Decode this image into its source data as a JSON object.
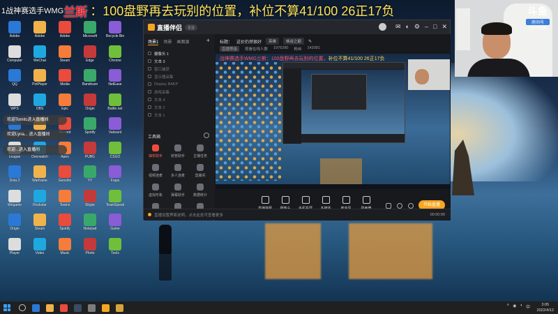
{
  "overlay": {
    "prefix": "1战神赛选手WMG",
    "prefix_red": "兰斯",
    "headline": "：100盘野再去玩别的位置，补位不算41/100 26正17负"
  },
  "chat": [
    "欢迎Tomitc进入直播间",
    "欢迎Lyna... 进入直播间",
    "欢迎...进入直播间"
  ],
  "desktop_icons": [
    "Adobe",
    "Adobe",
    "Adobe",
    "Microsoft",
    "Recycle Bin",
    "Computer",
    "WeChat",
    "Steam",
    "Edge",
    "Chrome",
    "QQ",
    "PotPlayer",
    "Media",
    "Bandicam",
    "NetEase",
    "WPS",
    "OBS",
    "Epic",
    "Origin",
    "Battle.net",
    "Uplay",
    "GOG",
    "Discord",
    "Spotify",
    "Valorant",
    "League",
    "Overwatch",
    "Apex",
    "PUBG",
    "CSGO",
    "Dota 2",
    "Warframe",
    "Genshin",
    "YY",
    "Fraps",
    "Wegame",
    "Rockstar",
    "Teams",
    "Skype",
    "TeamSpeak",
    "Origin",
    "Steam",
    "Spotify",
    "Notepad",
    "Game",
    "Player",
    "Video",
    "Music",
    "Photo",
    "Tools"
  ],
  "webcam_logo": {
    "brand": "斗鱼",
    "subtitle": "房间号",
    "room": "1976280"
  },
  "app": {
    "brand": "直播伴侣",
    "badge": "企业",
    "tabs": [
      "场景1",
      "场景",
      "画面源"
    ],
    "sources": [
      {
        "name": "摄像头 1",
        "on": true
      },
      {
        "name": "文本 3",
        "on": true
      },
      {
        "name": "窗口捕获",
        "on": false
      },
      {
        "name": "显示器采集",
        "on": false
      },
      {
        "name": "Display BAKP",
        "on": false
      },
      {
        "name": "游戏采集",
        "on": false
      },
      {
        "name": "文本 4",
        "on": false
      },
      {
        "name": "文本 2",
        "on": false
      },
      {
        "name": "文本 1",
        "on": false
      }
    ],
    "tools_title": "工具箱",
    "tools": [
      {
        "label": "抽奖助手",
        "hot": true
      },
      {
        "label": "房管助手",
        "hot": false
      },
      {
        "label": "主播任务",
        "hot": false
      },
      {
        "label": "视频连麦",
        "hot": false
      },
      {
        "label": "多人连麦",
        "hot": false
      },
      {
        "label": "直播间",
        "hot": false
      },
      {
        "label": "虚拟形象",
        "hot": false
      },
      {
        "label": "弹幕助手",
        "hot": false
      },
      {
        "label": "数据统计",
        "hot": false
      },
      {
        "label": "画中画",
        "hot": false
      },
      {
        "label": "背景音乐",
        "hot": false
      },
      {
        "label": "更多",
        "hot": false
      }
    ],
    "topinfo": {
      "label": "标题：",
      "title": "这价仍然很好",
      "category": "英雄",
      "tag": "峡谷之巅"
    },
    "row2": {
      "level": "直播等级",
      "fans_label": "粉丝",
      "room_label": "观看在线人数",
      "viewers": "1976280",
      "hot": "142081"
    },
    "preview_ticker_red": "战神赛选手WMG兰斯：100盘野再去玩别的位置，",
    "preview_ticker_yellow": "补位不算41/100 26正17负",
    "actions": [
      "直播弹幕",
      "摄像头",
      "手机投屏",
      "多媒体",
      "麦克风",
      "扬声器"
    ],
    "go_live": "开始直播",
    "status": "直播设置界面说明，点击此处可查看更多",
    "timer": "00:00:00"
  },
  "taskbar": {
    "time": "3:05",
    "date": "2022/4/12",
    "lang": "中"
  },
  "colors": {
    "accent": "#f6a623",
    "headline": "#ffe45c",
    "headline_red": "#e81e2e"
  }
}
